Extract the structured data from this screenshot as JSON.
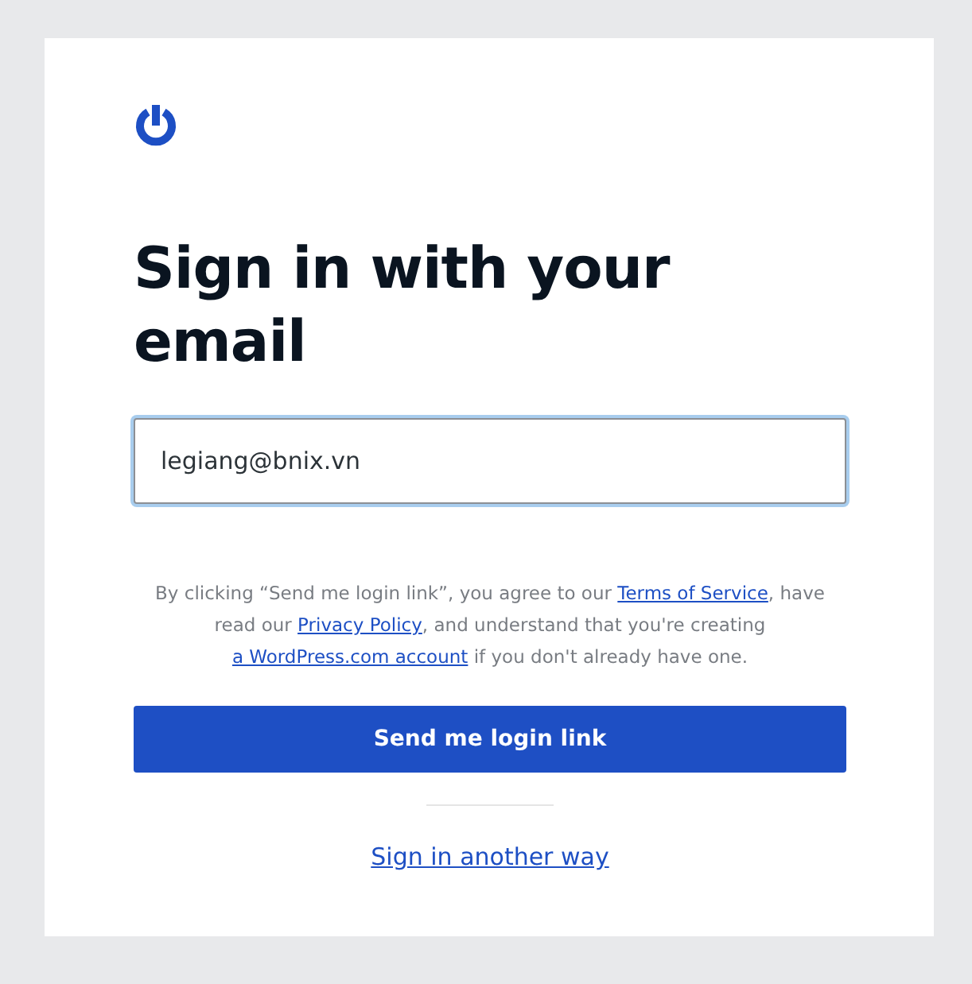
{
  "heading": "Sign in with your email",
  "email_field": {
    "value": "legiang@bnix.vn",
    "focused": true
  },
  "legal": [
    {
      "kind": "text",
      "text": "By clicking “Send me login link”, you agree to our "
    },
    {
      "kind": "link",
      "text": "Terms of Service"
    },
    {
      "kind": "text",
      "text": ", have read our "
    },
    {
      "kind": "link",
      "text": "Privacy Policy"
    },
    {
      "kind": "text",
      "text": ", and understand that you're creating "
    },
    {
      "kind": "link",
      "text": "a WordPress.com account"
    },
    {
      "kind": "text",
      "text": " if you don't already have one."
    }
  ],
  "submit_button": "Send me login link",
  "alternate_link": "Sign in another way"
}
